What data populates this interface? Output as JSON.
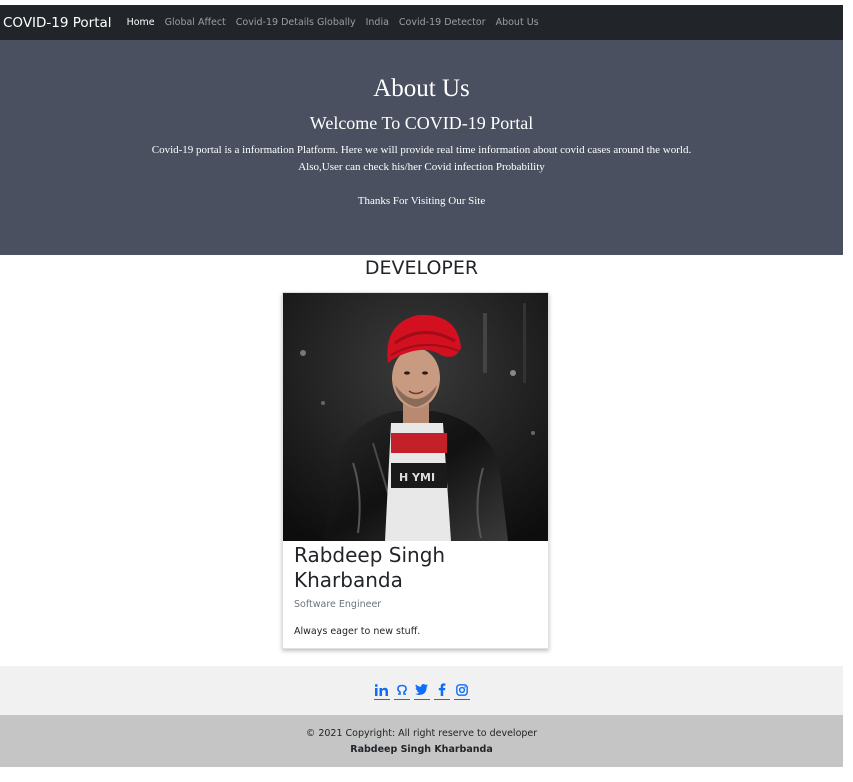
{
  "navbar": {
    "brand": "COVID-19 Portal",
    "links": [
      {
        "label": "Home",
        "active": true
      },
      {
        "label": "Global Affect"
      },
      {
        "label": "Covid-19 Details Globally"
      },
      {
        "label": "India"
      },
      {
        "label": "Covid-19 Detector"
      },
      {
        "label": "About Us"
      }
    ]
  },
  "hero": {
    "title": "About Us",
    "subtitle": "Welcome To COVID-19 Portal",
    "description_line1": "Covid-19 portal is a information Platform. Here we will provide real time information about covid cases around the world.",
    "description_line2": "Also,User can check his/her Covid infection Probability",
    "thanks": "Thanks For Visiting Our Site"
  },
  "developer": {
    "heading": "DEVELOPER",
    "name": "Rabdeep Singh Kharbanda",
    "role": "Software Engineer",
    "bio": "Always eager to new stuff."
  },
  "footer": {
    "social_icons": [
      "linkedin-icon",
      "github-icon",
      "twitter-icon",
      "facebook-icon",
      "instagram-icon"
    ],
    "copyright": "© 2021 Copyright: All right reserve to developer",
    "developer_name": "Rabdeep Singh Kharbanda"
  },
  "colors": {
    "navbar_bg": "#212529",
    "hero_bg": "#4a5060",
    "link_blue": "#0d6efd",
    "social_bar_bg": "#f1f1f1",
    "copyright_bg": "#c5c5c5"
  }
}
